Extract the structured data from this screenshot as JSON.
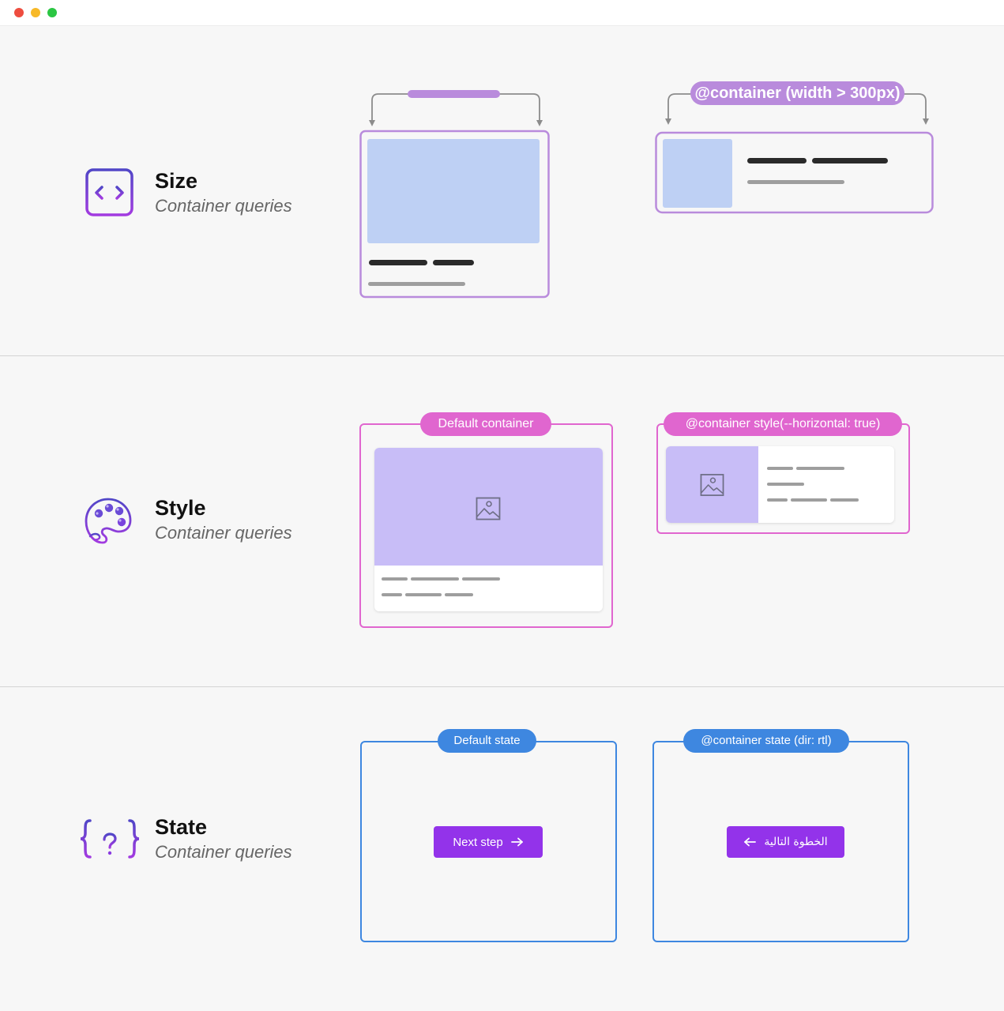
{
  "window": {
    "controls": [
      {
        "name": "close",
        "color": "#ee4d3f"
      },
      {
        "name": "minimize",
        "color": "#f7b928"
      },
      {
        "name": "maximize",
        "color": "#2bc643"
      }
    ]
  },
  "sections": {
    "size": {
      "title": "Size",
      "subtitle": "Container queries",
      "icon": "resize-horizontal-icon",
      "query_label": "@container  (width > 300px)"
    },
    "style": {
      "title": "Style",
      "subtitle": "Container queries",
      "icon": "palette-icon",
      "default_label": "Default container",
      "query_label": "@container style(--horizontal: true)"
    },
    "state": {
      "title": "State",
      "subtitle": "Container queries",
      "icon": "curly-braces-question-icon",
      "default_label": "Default state",
      "query_label": "@container state (dir: rtl)",
      "button_ltr": "Next step",
      "button_rtl": "الخطوة التالية"
    }
  },
  "colors": {
    "size_accent": "#b98bdc",
    "style_accent": "#e066cf",
    "state_accent": "#3e87e0",
    "button": "#9333ea",
    "image_blue": "#bed0f4",
    "image_lavender": "#c8bdf7"
  }
}
